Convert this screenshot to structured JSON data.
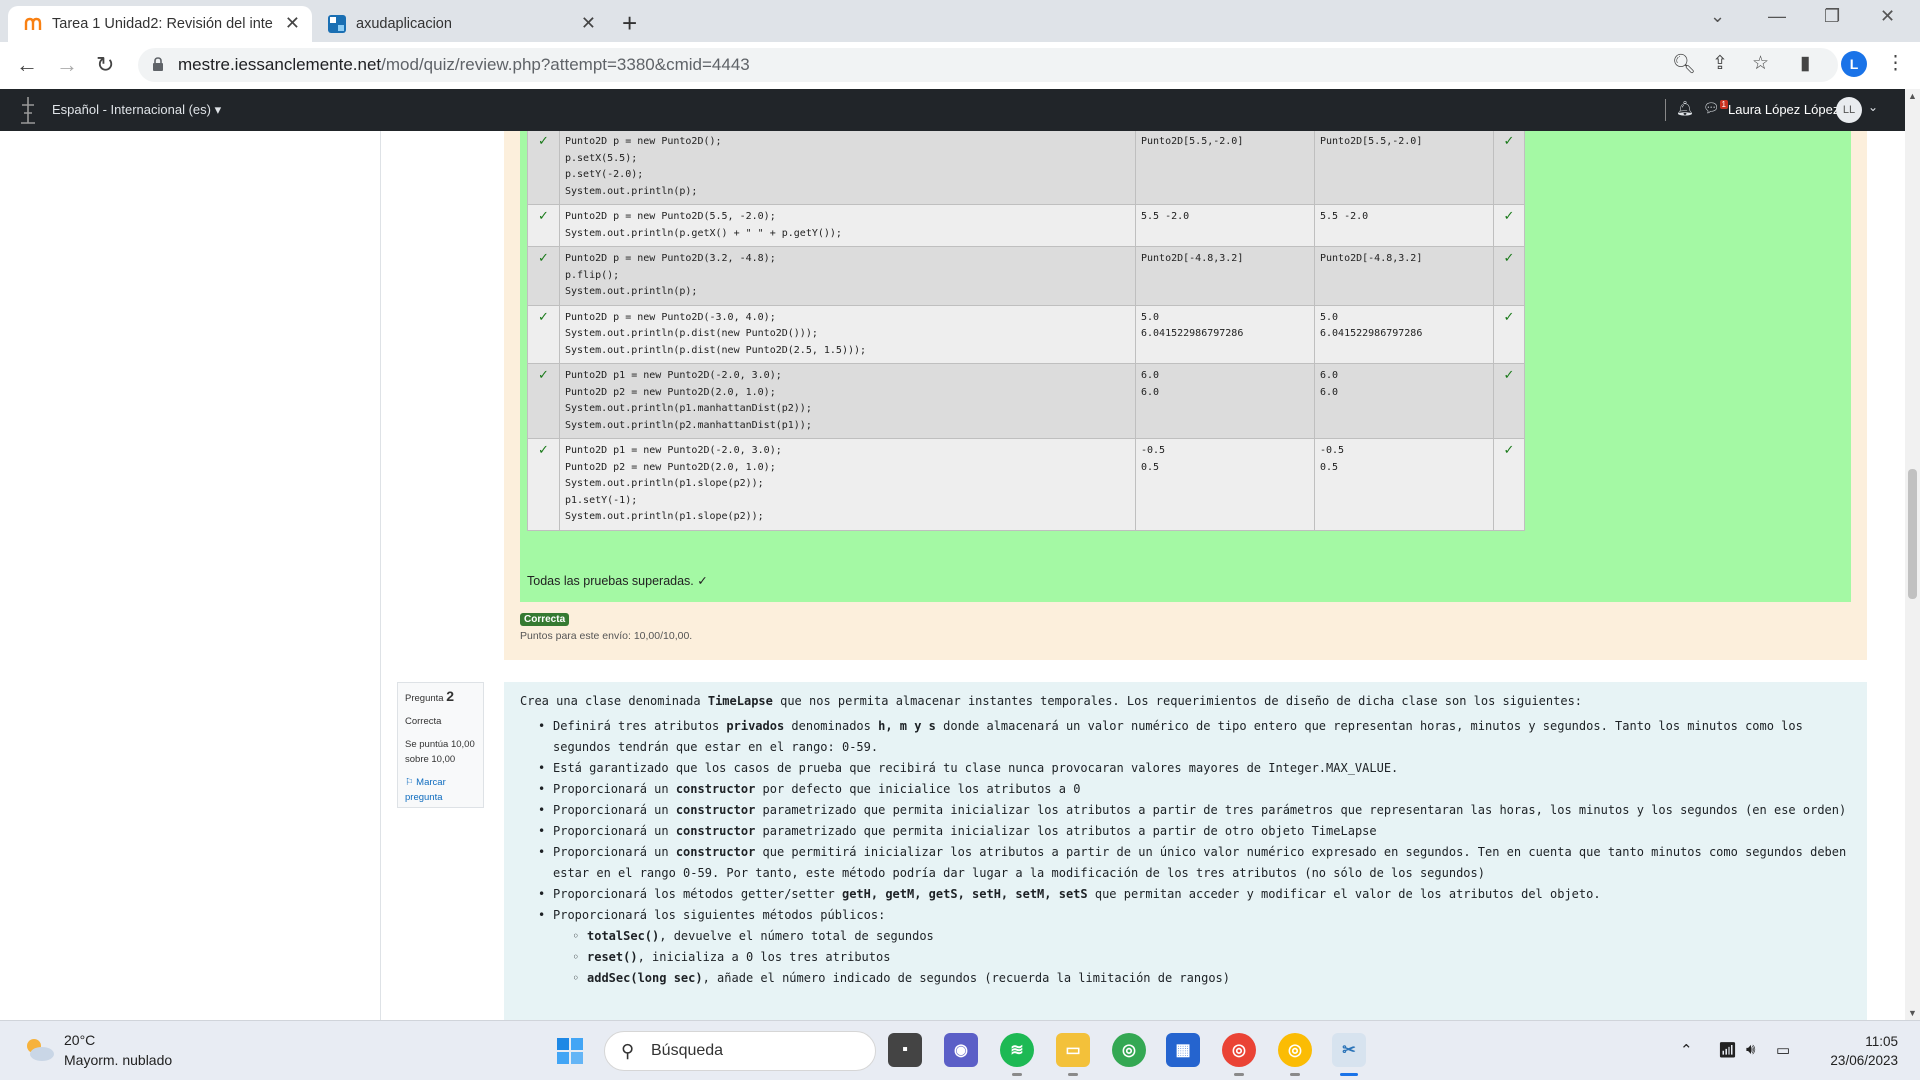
{
  "browser": {
    "tabs": [
      {
        "title": "Tarea 1 Unidad2: Revisión del inte",
        "active": true
      },
      {
        "title": "axudaplicacion",
        "active": false
      }
    ],
    "url_host": "mestre.iessanclemente.net",
    "url_path": "/mod/quiz/review.php?attempt=3380&cmid=4443",
    "profile_initial": "L"
  },
  "moodle_nav": {
    "language": "Español - Internacional (es) ▾",
    "user_name": "Laura López López",
    "avatar_initials": "LL",
    "messages_count": "1"
  },
  "question1": {
    "test_rows": [
      {
        "code": "Punto2D p = new Punto2D();\np.setX(5.5);\np.setY(-2.0);\nSystem.out.println(p);",
        "expected": "Punto2D[5.5,-2.0]",
        "got": "Punto2D[5.5,-2.0]"
      },
      {
        "code": "Punto2D p = new Punto2D(5.5, -2.0);\nSystem.out.println(p.getX() + \" \" + p.getY());",
        "expected": "5.5 -2.0",
        "got": "5.5 -2.0"
      },
      {
        "code": "Punto2D p = new Punto2D(3.2, -4.8);\np.flip();\nSystem.out.println(p);",
        "expected": "Punto2D[-4.8,3.2]",
        "got": "Punto2D[-4.8,3.2]"
      },
      {
        "code": "Punto2D p = new Punto2D(-3.0, 4.0);\nSystem.out.println(p.dist(new Punto2D()));\nSystem.out.println(p.dist(new Punto2D(2.5, 1.5)));",
        "expected": "5.0\n6.041522986797286",
        "got": "5.0\n6.041522986797286"
      },
      {
        "code": "Punto2D p1 = new Punto2D(-2.0, 3.0);\nPunto2D p2 = new Punto2D(2.0, 1.0);\nSystem.out.println(p1.manhattanDist(p2));\nSystem.out.println(p2.manhattanDist(p1));",
        "expected": "6.0\n6.0",
        "got": "6.0\n6.0"
      },
      {
        "code": "Punto2D p1 = new Punto2D(-2.0, 3.0);\nPunto2D p2 = new Punto2D(2.0, 1.0);\nSystem.out.println(p1.slope(p2));\np1.setY(-1);\nSystem.out.println(p1.slope(p2));",
        "expected": "-0.5\n0.5",
        "got": "-0.5\n0.5"
      }
    ],
    "all_passed": "Todas las pruebas superadas. ✓",
    "status_badge": "Correcta",
    "points": "Puntos para este envío: 10,00/10,00."
  },
  "question2": {
    "info": {
      "label": "Pregunta",
      "number": "2",
      "status": "Correcta",
      "score": "Se puntúa 10,00 sobre 10,00",
      "flag": "Marcar pregunta"
    },
    "intro_pre": "Crea una clase denominada ",
    "intro_bold": "TimeLapse",
    "intro_post": " que nos permita almacenar instantes temporales. Los requerimientos de diseño de dicha clase son los siguientes:",
    "bullets": [
      {
        "level": 1,
        "parts": [
          [
            "Definirá tres atributos ",
            false
          ],
          [
            "privados",
            true
          ],
          [
            " denominados ",
            false
          ],
          [
            "h, m y s",
            true
          ],
          [
            " donde almacenará un valor numérico de tipo entero que representan horas, minutos y segundos. Tanto los minutos como los segundos tendrán que estar en el rango: 0-59.",
            false
          ]
        ]
      },
      {
        "level": 1,
        "parts": [
          [
            "Está garantizado que los casos de prueba que recibirá tu clase nunca provocaran valores mayores de Integer.MAX_VALUE.",
            false
          ]
        ]
      },
      {
        "level": 1,
        "parts": [
          [
            "Proporcionará un ",
            false
          ],
          [
            "constructor",
            true
          ],
          [
            " por defecto que inicialice los atributos a 0",
            false
          ]
        ]
      },
      {
        "level": 1,
        "parts": [
          [
            "Proporcionará un ",
            false
          ],
          [
            "constructor",
            true
          ],
          [
            " parametrizado que permita inicializar los atributos a partir de tres parámetros que representaran las horas, los minutos y los segundos (en ese orden)",
            false
          ]
        ]
      },
      {
        "level": 1,
        "parts": [
          [
            "Proporcionará un ",
            false
          ],
          [
            "constructor",
            true
          ],
          [
            " parametrizado que permita inicializar los atributos a partir de otro objeto TimeLapse",
            false
          ]
        ]
      },
      {
        "level": 1,
        "parts": [
          [
            "Proporcionará un ",
            false
          ],
          [
            "constructor",
            true
          ],
          [
            " que permitirá inicializar los atributos a partir de un único valor numérico expresado en segundos. Ten en cuenta que tanto minutos como segundos deben estar en el rango 0-59. Por tanto, este método podría dar lugar a la modificación de los tres atributos (no sólo de los segundos)",
            false
          ]
        ]
      },
      {
        "level": 1,
        "parts": [
          [
            "Proporcionará los métodos getter/setter ",
            false
          ],
          [
            "getH, getM, getS, setH, setM, setS",
            true
          ],
          [
            " que permitan acceder y modificar el valor de los atributos del objeto.",
            false
          ]
        ]
      },
      {
        "level": 1,
        "parts": [
          [
            "Proporcionará los siguientes métodos públicos:",
            false
          ]
        ]
      },
      {
        "level": 2,
        "parts": [
          [
            "totalSec()",
            true
          ],
          [
            ", devuelve el número total de segundos",
            false
          ]
        ]
      },
      {
        "level": 2,
        "parts": [
          [
            "reset()",
            true
          ],
          [
            ", inicializa a 0 los tres atributos",
            false
          ]
        ]
      },
      {
        "level": 2,
        "parts": [
          [
            "addSec(long sec)",
            true
          ],
          [
            ", añade el número indicado de segundos (recuerda la limitación de rangos)",
            false
          ]
        ]
      }
    ]
  },
  "taskbar": {
    "weather_temp": "20°C",
    "weather_desc": "Mayorm. nublado",
    "search_placeholder": "Búsqueda",
    "time": "11:05",
    "date": "23/06/2023"
  },
  "colors": {
    "pass_green": "#a4f9a4",
    "answer_bg": "#fcefdc",
    "question_bg": "#e7f3f5",
    "badge_green": "#357a32",
    "moodle_nav": "#212529"
  }
}
